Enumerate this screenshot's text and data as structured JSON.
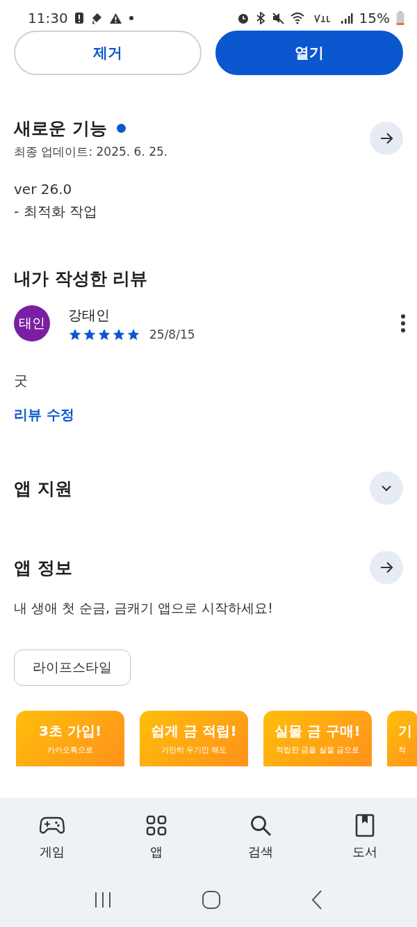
{
  "status_bar": {
    "time": "11:30",
    "battery": "15%"
  },
  "actions": [
    {
      "label": "제거",
      "kind": "outline"
    },
    {
      "label": "열기",
      "kind": "filled"
    }
  ],
  "whats_new": {
    "title": "새로운 기능",
    "new_dot": true,
    "updated": "최종 업데이트: 2025. 6. 25.",
    "lines": [
      "ver 26.0",
      "- 최적화 작업"
    ]
  },
  "my_review": {
    "title": "내가 작성한 리뷰",
    "avatar": "태인",
    "author": "강태인",
    "stars": 5,
    "date": "25/8/15",
    "body": "굿",
    "edit_link": "리뷰 수정"
  },
  "app_support": {
    "title": "앱 지원",
    "expanded": false
  },
  "app_info": {
    "title": "앱 정보",
    "description": "내 생애 첫 순금, 금캐기 앱으로 시작하세요!",
    "tag": "라이프스타일"
  },
  "screenshots": [
    {
      "headline": "3초 가입!",
      "caption": "카카오톡으로"
    },
    {
      "headline": "쉽게 금 적립!",
      "caption": "가만히 두기만 해도"
    },
    {
      "headline": "실물 금 구매!",
      "caption": "적립한 금을 실물 금으로"
    },
    {
      "headline": "기",
      "caption": "적"
    }
  ],
  "bottom_nav": [
    {
      "label": "게임"
    },
    {
      "label": "앱"
    },
    {
      "label": "검색"
    },
    {
      "label": "도서"
    }
  ]
}
